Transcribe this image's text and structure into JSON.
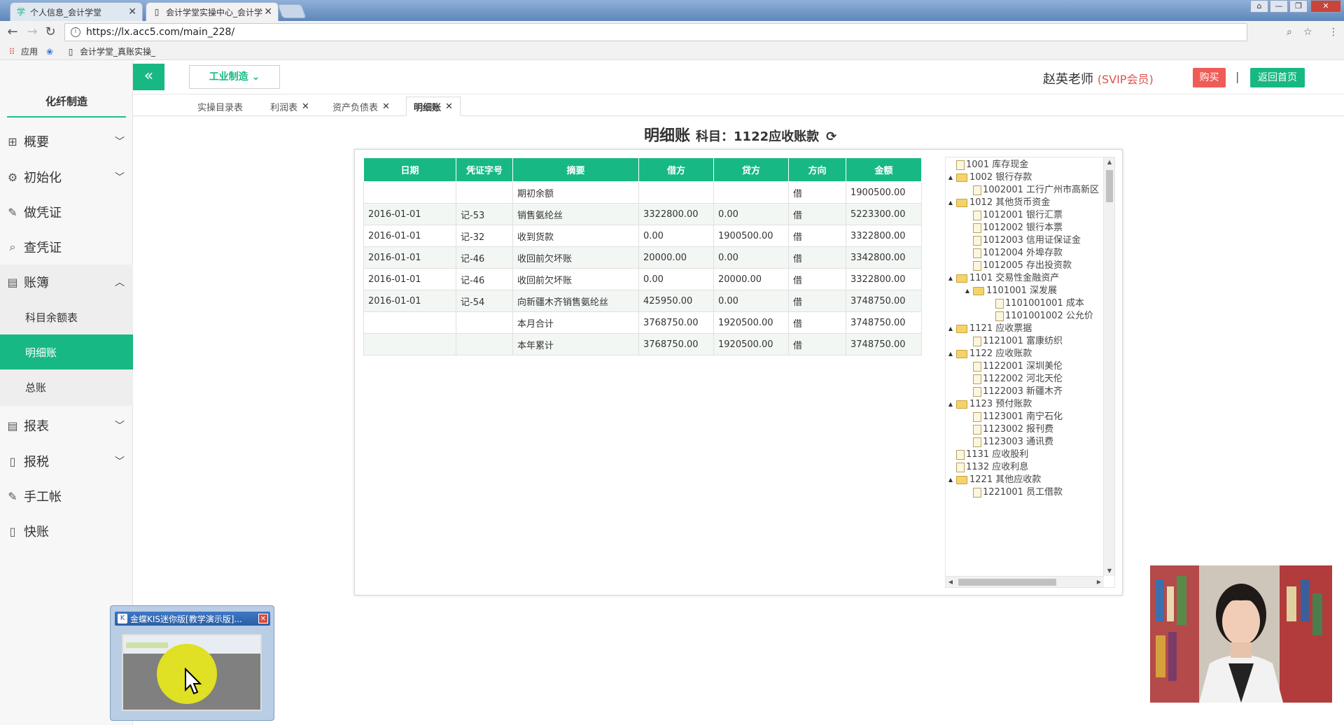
{
  "browser": {
    "tabs": [
      {
        "title": "个人信息_会计学堂",
        "icon": "logo-icon"
      },
      {
        "title": "会计学堂实操中心_会计学",
        "icon": "page-icon"
      }
    ],
    "url": "https://lx.acc5.com/main_228/",
    "bookmarks": [
      {
        "label": "应用",
        "icon": "apps-grid-icon"
      },
      {
        "label": "",
        "icon": "paw-icon"
      },
      {
        "label": "会计学堂_真账实操_",
        "icon": "page-icon"
      }
    ]
  },
  "sidebar": {
    "company": "化纤制造",
    "items": [
      {
        "label": "概要",
        "icon": "grid-icon",
        "arrow": "down"
      },
      {
        "label": "初始化",
        "icon": "gear-icon",
        "arrow": "down"
      },
      {
        "label": "做凭证",
        "icon": "pen-icon"
      },
      {
        "label": "查凭证",
        "icon": "search-icon"
      },
      {
        "label": "账簿",
        "icon": "book-icon",
        "arrow": "up"
      },
      {
        "label": "报表",
        "icon": "list-icon",
        "arrow": "down"
      },
      {
        "label": "报税",
        "icon": "file-icon",
        "arrow": "down"
      },
      {
        "label": "手工帐",
        "icon": "pen-icon"
      },
      {
        "label": "快账",
        "icon": "file-icon"
      }
    ],
    "submenu": [
      "科目余额表",
      "明细账",
      "总账"
    ],
    "active_submenu": "明细账"
  },
  "header": {
    "industry": "工业制造",
    "user": "赵英老师",
    "membership": "(SVIP会员)",
    "buy": "购买",
    "separator": "|",
    "home": "返回首页"
  },
  "page_tabs": [
    {
      "label": "实操目录表",
      "closable": false
    },
    {
      "label": "利润表",
      "closable": true
    },
    {
      "label": "资产负债表",
      "closable": true
    },
    {
      "label": "明细账",
      "closable": true,
      "active": true
    }
  ],
  "title": {
    "main": "明细账",
    "subject": "科目：1122应收账款"
  },
  "ledger": {
    "columns": [
      "日期",
      "凭证字号",
      "摘要",
      "借方",
      "贷方",
      "方向",
      "金额"
    ],
    "rows": [
      [
        "",
        "",
        "期初余额",
        "",
        "",
        "借",
        "1900500.00"
      ],
      [
        "2016-01-01",
        "记-53",
        "销售氨纶丝",
        "3322800.00",
        "0.00",
        "借",
        "5223300.00"
      ],
      [
        "2016-01-01",
        "记-32",
        "收到货款",
        "0.00",
        "1900500.00",
        "借",
        "3322800.00"
      ],
      [
        "2016-01-01",
        "记-46",
        "收回前欠坏账",
        "20000.00",
        "0.00",
        "借",
        "3342800.00"
      ],
      [
        "2016-01-01",
        "记-46",
        "收回前欠坏账",
        "0.00",
        "20000.00",
        "借",
        "3322800.00"
      ],
      [
        "2016-01-01",
        "记-54",
        "向新疆木齐销售氨纶丝",
        "425950.00",
        "0.00",
        "借",
        "3748750.00"
      ],
      [
        "",
        "",
        "本月合计",
        "3768750.00",
        "1920500.00",
        "借",
        "3748750.00"
      ],
      [
        "",
        "",
        "本年累计",
        "3768750.00",
        "1920500.00",
        "借",
        "3748750.00"
      ]
    ]
  },
  "tree": [
    {
      "label": "1001 库存现金",
      "level": 0,
      "type": "doc"
    },
    {
      "label": "1002 银行存款",
      "level": 0,
      "type": "folder"
    },
    {
      "label": "1002001 工行广州市高新区",
      "level": 1,
      "type": "doc"
    },
    {
      "label": "1012 其他货币资金",
      "level": 0,
      "type": "folder"
    },
    {
      "label": "1012001 银行汇票",
      "level": 1,
      "type": "doc"
    },
    {
      "label": "1012002 银行本票",
      "level": 1,
      "type": "doc"
    },
    {
      "label": "1012003 信用证保证金",
      "level": 1,
      "type": "doc"
    },
    {
      "label": "1012004 外埠存款",
      "level": 1,
      "type": "doc"
    },
    {
      "label": "1012005 存出投资款",
      "level": 1,
      "type": "doc"
    },
    {
      "label": "1101 交易性金融资产",
      "level": 0,
      "type": "folder"
    },
    {
      "label": "1101001 深发展",
      "level": 1,
      "type": "folder"
    },
    {
      "label": "1101001001 成本",
      "level": 2,
      "type": "doc"
    },
    {
      "label": "1101001002 公允价",
      "level": 2,
      "type": "doc"
    },
    {
      "label": "1121 应收票据",
      "level": 0,
      "type": "folder"
    },
    {
      "label": "1121001 富康纺织",
      "level": 1,
      "type": "doc"
    },
    {
      "label": "1122 应收账款",
      "level": 0,
      "type": "folder"
    },
    {
      "label": "1122001 深圳美伦",
      "level": 1,
      "type": "doc"
    },
    {
      "label": "1122002 河北天伦",
      "level": 1,
      "type": "doc"
    },
    {
      "label": "1122003 新疆木齐",
      "level": 1,
      "type": "doc"
    },
    {
      "label": "1123 预付账款",
      "level": 0,
      "type": "folder"
    },
    {
      "label": "1123001 南宁石化",
      "level": 1,
      "type": "doc"
    },
    {
      "label": "1123002 报刊费",
      "level": 1,
      "type": "doc"
    },
    {
      "label": "1123003 通讯费",
      "level": 1,
      "type": "doc"
    },
    {
      "label": "1131 应收股利",
      "level": 0,
      "type": "doc"
    },
    {
      "label": "1132 应收利息",
      "level": 0,
      "type": "doc"
    },
    {
      "label": "1221 其他应收款",
      "level": 0,
      "type": "folder"
    },
    {
      "label": "1221001 员工借款",
      "level": 1,
      "type": "doc"
    }
  ],
  "taskbar_popup": {
    "title": "金蝶KIS迷你版[教学演示版]..."
  }
}
